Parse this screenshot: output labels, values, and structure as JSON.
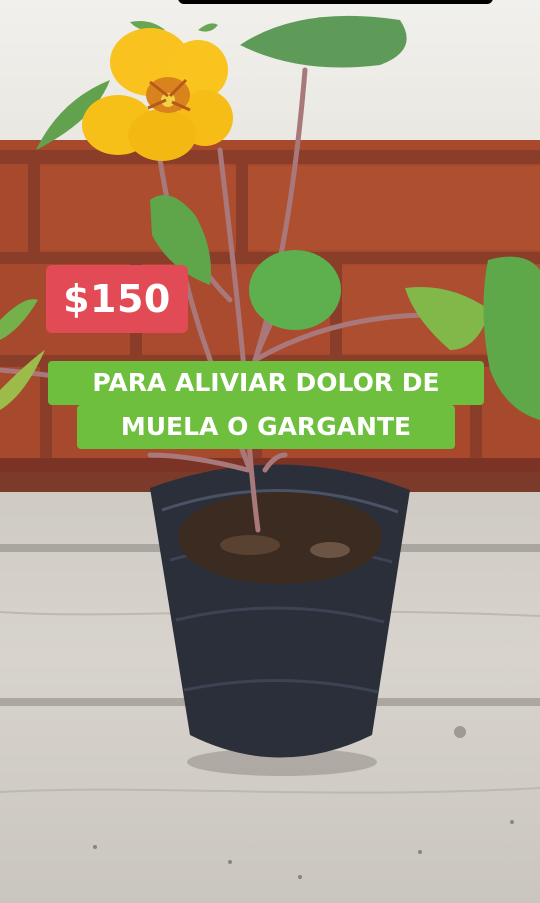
{
  "photo": {
    "subject": "potted nasturtium plant",
    "colors": {
      "flower": "#f9c21f",
      "leaf": "#5aa84a",
      "pot": "#2a2f3a",
      "bricks": "#a4472b",
      "table": "#d2cec7"
    }
  },
  "price_tag": {
    "text": "$150",
    "color": "#e24b55"
  },
  "caption": {
    "line1": "PARA ALIVIAR DOLOR DE",
    "line2": "MUELA O GARGANTE",
    "color": "#6fbf3f"
  }
}
